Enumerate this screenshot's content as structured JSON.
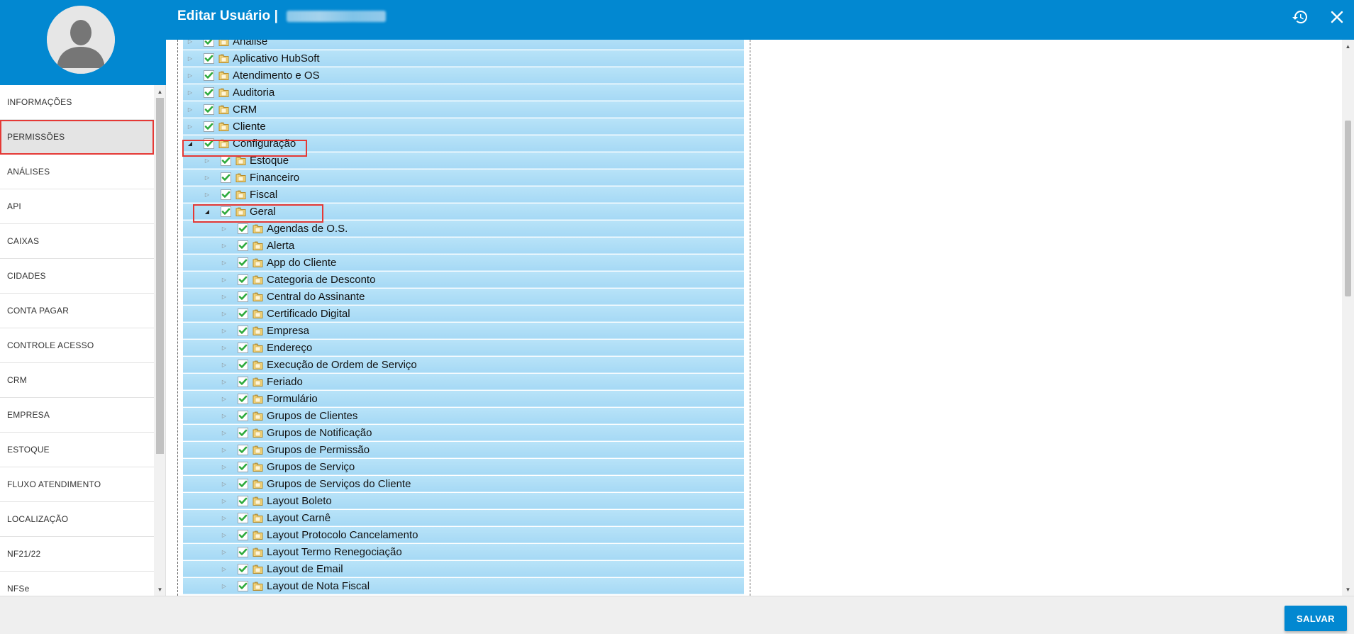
{
  "header": {
    "title": "Editar Usuário |"
  },
  "sidebar": {
    "items": [
      {
        "label": "INFORMAÇÕES"
      },
      {
        "label": "PERMISSÕES"
      },
      {
        "label": "ANÁLISES"
      },
      {
        "label": "API"
      },
      {
        "label": "CAIXAS"
      },
      {
        "label": "CIDADES"
      },
      {
        "label": "CONTA PAGAR"
      },
      {
        "label": "CONTROLE ACESSO"
      },
      {
        "label": "CRM"
      },
      {
        "label": "EMPRESA"
      },
      {
        "label": "ESTOQUE"
      },
      {
        "label": "FLUXO ATENDIMENTO"
      },
      {
        "label": "LOCALIZAÇÃO"
      },
      {
        "label": "NF21/22"
      },
      {
        "label": "NFSe"
      }
    ]
  },
  "tree": {
    "rows": [
      {
        "label": "Análise",
        "level": 0,
        "expanded": false
      },
      {
        "label": "Aplicativo HubSoft",
        "level": 0,
        "expanded": false
      },
      {
        "label": "Atendimento e OS",
        "level": 0,
        "expanded": false
      },
      {
        "label": "Auditoria",
        "level": 0,
        "expanded": false
      },
      {
        "label": "CRM",
        "level": 0,
        "expanded": false
      },
      {
        "label": "Cliente",
        "level": 0,
        "expanded": false
      },
      {
        "label": "Configuração",
        "level": 0,
        "expanded": true
      },
      {
        "label": "Estoque",
        "level": 1,
        "expanded": false
      },
      {
        "label": "Financeiro",
        "level": 1,
        "expanded": false
      },
      {
        "label": "Fiscal",
        "level": 1,
        "expanded": false
      },
      {
        "label": "Geral",
        "level": 1,
        "expanded": true
      },
      {
        "label": "Agendas de O.S.",
        "level": 2,
        "expanded": false
      },
      {
        "label": "Alerta",
        "level": 2,
        "expanded": false
      },
      {
        "label": "App do Cliente",
        "level": 2,
        "expanded": false
      },
      {
        "label": "Categoria de Desconto",
        "level": 2,
        "expanded": false
      },
      {
        "label": "Central do Assinante",
        "level": 2,
        "expanded": false
      },
      {
        "label": "Certificado Digital",
        "level": 2,
        "expanded": false
      },
      {
        "label": "Empresa",
        "level": 2,
        "expanded": false
      },
      {
        "label": "Endereço",
        "level": 2,
        "expanded": false
      },
      {
        "label": "Execução de Ordem de Serviço",
        "level": 2,
        "expanded": false
      },
      {
        "label": "Feriado",
        "level": 2,
        "expanded": false
      },
      {
        "label": "Formulário",
        "level": 2,
        "expanded": false
      },
      {
        "label": "Grupos de Clientes",
        "level": 2,
        "expanded": false
      },
      {
        "label": "Grupos de Notificação",
        "level": 2,
        "expanded": false
      },
      {
        "label": "Grupos de Permissão",
        "level": 2,
        "expanded": false
      },
      {
        "label": "Grupos de Serviço",
        "level": 2,
        "expanded": false
      },
      {
        "label": "Grupos de Serviços do Cliente",
        "level": 2,
        "expanded": false
      },
      {
        "label": "Layout Boleto",
        "level": 2,
        "expanded": false
      },
      {
        "label": "Layout Carnê",
        "level": 2,
        "expanded": false
      },
      {
        "label": "Layout Protocolo Cancelamento",
        "level": 2,
        "expanded": false
      },
      {
        "label": "Layout Termo Renegociação",
        "level": 2,
        "expanded": false
      },
      {
        "label": "Layout de Email",
        "level": 2,
        "expanded": false
      },
      {
        "label": "Layout de Nota Fiscal",
        "level": 2,
        "expanded": false
      }
    ]
  },
  "footer": {
    "save_label": "SALVAR"
  },
  "colors": {
    "primary": "#0288d1",
    "tree_row": "#b3e0f7",
    "highlight": "#e53935",
    "check": "#2eaa3c"
  },
  "icons": {
    "avatar": "user-silhouette-icon",
    "history": "history-icon",
    "close": "close-icon",
    "checkbox": "checkbox-checked-icon",
    "folder": "folder-icon",
    "expander": "triangle-expander-icon"
  }
}
